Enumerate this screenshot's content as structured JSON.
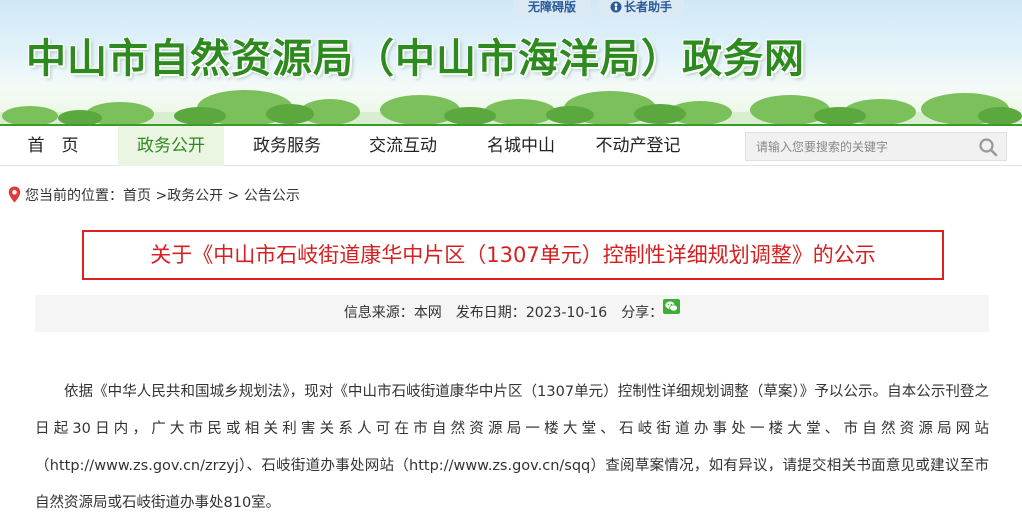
{
  "header": {
    "site_title": "中山市自然资源局（中山市海洋局）政务网",
    "accessibility_label": "无障碍版",
    "elder_mode_label": "长者助手"
  },
  "nav": {
    "items": [
      {
        "label": "首　页"
      },
      {
        "label": "政务公开"
      },
      {
        "label": "政务服务"
      },
      {
        "label": "交流互动"
      },
      {
        "label": "名城中山"
      },
      {
        "label": "不动产登记"
      }
    ],
    "active_index": 1,
    "search_placeholder": "请输入您要搜索的关键字"
  },
  "breadcrumb": {
    "prefix": "您当前的位置：",
    "home": "首页",
    "sep1": " >",
    "section": "政务公开",
    "sep2": " > ",
    "current": "公告公示"
  },
  "article": {
    "title": "关于《中山市石岐街道康华中片区（1307单元）控制性详细规划调整》的公示",
    "source_label": "信息来源：",
    "source": "本网",
    "date_label": "发布日期：",
    "date": "2023-10-16",
    "share_label": "分享：",
    "body": "依据《中华人民共和国城乡规划法》，现对《中山市石岐街道康华中片区（1307单元）控制性详细规划调整（草案）》予以公示。自本公示刊登之日起30日内，广大市民或相关利害关系人可在市自然资源局一楼大堂、石岐街道办事处一楼大堂、市自然资源局网站（http://www.zs.gov.cn/zrzyj）、石岐街道办事处网站（http://www.zs.gov.cn/sqq）查阅草案情况，如有异议，请提交相关书面意见或建议至市自然资源局或石岐街道办事处810室。"
  },
  "colors": {
    "brand_green": "#2d8a1e",
    "title_red": "#d42020"
  }
}
